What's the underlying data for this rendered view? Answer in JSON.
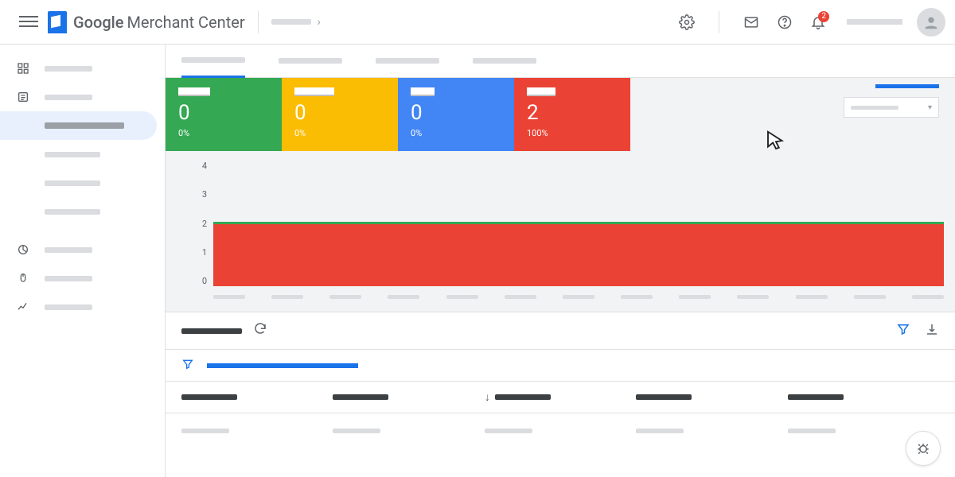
{
  "app": {
    "brand": "Google",
    "product": "Merchant Center"
  },
  "notifications": {
    "count": "2"
  },
  "colors": {
    "green": "#34a853",
    "amber": "#fbbc04",
    "blue": "#4285f4",
    "red": "#ea4335",
    "primary": "#1a73e8"
  },
  "status_cards": [
    {
      "value": "0",
      "pct": "0%",
      "color": "green"
    },
    {
      "value": "0",
      "pct": "0%",
      "color": "amber"
    },
    {
      "value": "0",
      "pct": "0%",
      "color": "blue"
    },
    {
      "value": "2",
      "pct": "100%",
      "color": "red"
    }
  ],
  "chart_data": {
    "type": "area",
    "ylabel": "",
    "xlabel": "",
    "ylim": [
      0,
      4
    ],
    "y_ticks": [
      4,
      3,
      2,
      1,
      0
    ],
    "x_count": 13,
    "series": [
      {
        "name": "red-area",
        "color": "#ea4335",
        "constant_value": 2
      },
      {
        "name": "green-line",
        "color": "#34a853",
        "constant_value": 2
      }
    ]
  },
  "table": {
    "columns": 5,
    "sort_col_index": 2,
    "rows": 1
  }
}
